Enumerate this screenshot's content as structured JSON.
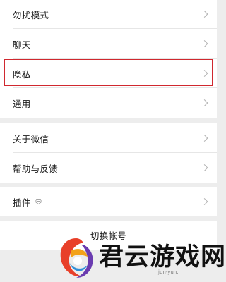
{
  "settings": {
    "group1": [
      {
        "label": "勿扰模式"
      },
      {
        "label": "聊天"
      },
      {
        "label": "隐私",
        "highlighted": true
      },
      {
        "label": "通用"
      }
    ],
    "group2": [
      {
        "label": "关于微信"
      },
      {
        "label": "帮助与反馈"
      }
    ],
    "group3": [
      {
        "label": "插件",
        "icon": "plugin-icon"
      }
    ],
    "switch_account_label": "切换帐号"
  },
  "watermark": {
    "brand_text": "君云游戏网",
    "url_text": "jun-yun.l"
  },
  "colors": {
    "background": "#ededed",
    "row_bg": "#ffffff",
    "highlight_border": "#d0282f",
    "chevron": "#b2b2b2"
  }
}
